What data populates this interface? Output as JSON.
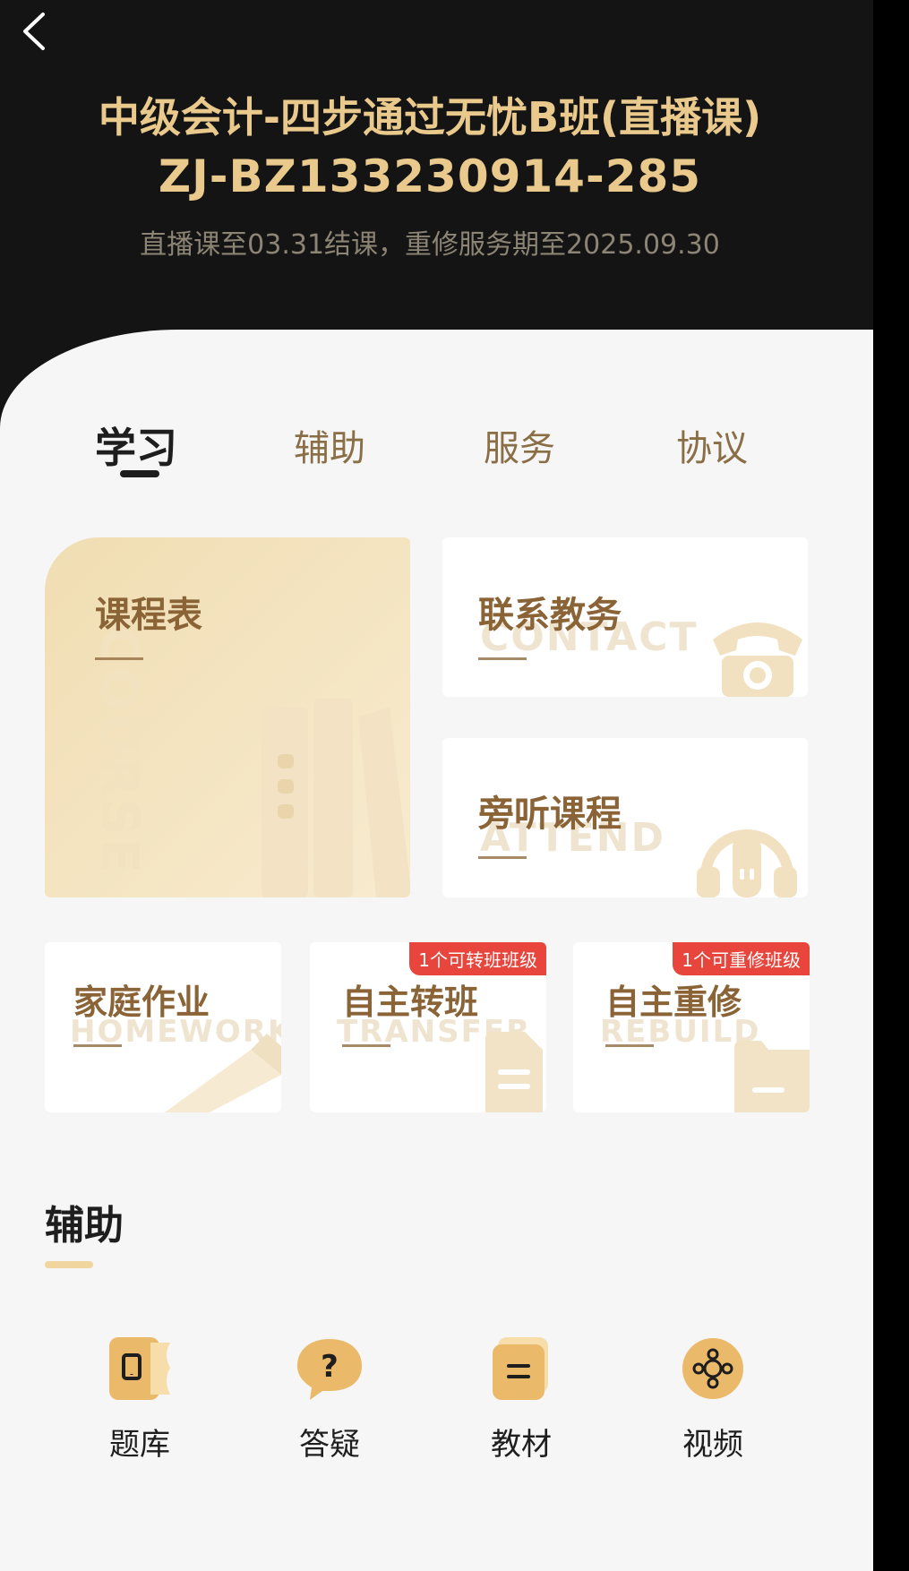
{
  "header": {
    "title_line1": "中级会计-四步通过无忧B班(直播课)",
    "title_line2": "ZJ-BZ133230914-285",
    "subtitle": "直播课至03.31结课，重修服务期至2025.09.30"
  },
  "tabs": [
    {
      "label": "学习",
      "active": true
    },
    {
      "label": "辅助",
      "active": false
    },
    {
      "label": "服务",
      "active": false
    },
    {
      "label": "协议",
      "active": false
    }
  ],
  "cards": {
    "schedule": {
      "label": "课程表",
      "watermark": "COURSE"
    },
    "contact": {
      "label": "联系教务",
      "watermark": "CONTACT"
    },
    "audit": {
      "label": "旁听课程",
      "watermark": "ATTEND"
    },
    "homework": {
      "label": "家庭作业",
      "watermark": "HOMEWORK"
    },
    "transfer": {
      "label": "自主转班",
      "watermark": "TRANSFER",
      "badge": "1个可转班班级"
    },
    "rebuild": {
      "label": "自主重修",
      "watermark": "REBUILD",
      "badge": "1个可重修班级"
    }
  },
  "assist_section": {
    "title": "辅助",
    "items": [
      {
        "label": "题库",
        "icon": "question-bank-icon"
      },
      {
        "label": "答疑",
        "icon": "question-bubble-icon"
      },
      {
        "label": "教材",
        "icon": "book-icon"
      },
      {
        "label": "视频",
        "icon": "video-reel-icon"
      }
    ]
  },
  "colors": {
    "header_bg": "#141414",
    "title_gold": "#e9c98c",
    "label_brown": "#8a6437",
    "badge_red": "#e8453c",
    "icon_gold": "#e9bf6b"
  }
}
